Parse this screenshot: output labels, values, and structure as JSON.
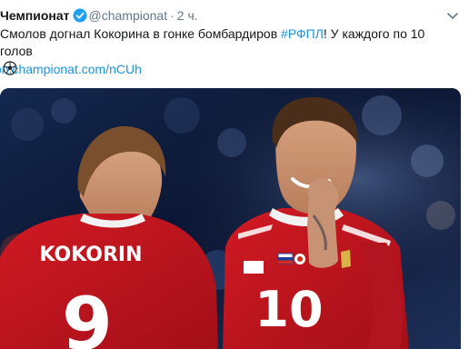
{
  "tweet": {
    "author_name": "Чемпионат",
    "author_handle": "@championat",
    "dot": "·",
    "time": "2 ч.",
    "text_before": "Смолов догнал Кокорина в гонке бомбардиров ",
    "hashtag": "#РФПЛ",
    "text_after": "! У каждого по 10 голов",
    "link": "on.championat.com/nCUh"
  },
  "media": {
    "left_player_name": "KOKORIN",
    "left_player_number": "9",
    "right_player_number": "10"
  },
  "colors": {
    "link": "#1b95e0",
    "muted": "#657786",
    "shirt_red": "#c8141e",
    "verified": "#1da1f2"
  },
  "icons": [
    "verified-badge-icon",
    "chevron-down-icon",
    "soccer-ball-icon"
  ]
}
